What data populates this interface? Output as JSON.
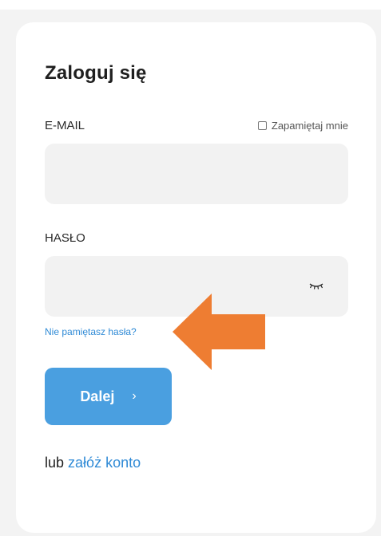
{
  "login": {
    "title": "Zaloguj się",
    "email_label": "E-MAIL",
    "remember_label": "Zapamiętaj mnie",
    "email_value": "",
    "password_label": "HASŁO",
    "password_value": "",
    "forgot_link": "Nie pamiętasz hasła?",
    "next_button": "Dalej",
    "next_chevron": "›",
    "alt_prefix": "lub",
    "alt_link": "załóż konto"
  },
  "icons": {
    "eye": "eye-closed-icon",
    "arrow": "arrow-left-annotation"
  },
  "colors": {
    "accent": "#4a9fe0",
    "link": "#2f8ad6",
    "arrow": "#ee7d32",
    "input_bg": "#f2f2f2",
    "page_bg": "#f3f3f3"
  }
}
